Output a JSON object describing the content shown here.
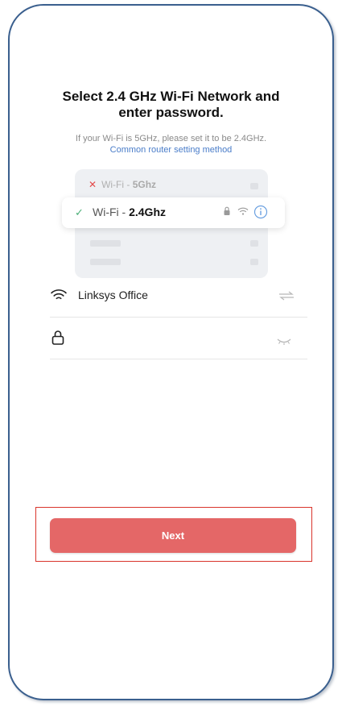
{
  "header": {
    "title_line1": "Select 2.4 GHz Wi-Fi Network and",
    "title_line2": "enter password.",
    "subtitle": "If your Wi-Fi is 5GHz, please set it to be 2.4GHz.",
    "router_link": "Common router setting method"
  },
  "illustration": {
    "bad_network_prefix": "Wi-Fi - ",
    "bad_network_band": "5Ghz",
    "good_network_prefix": "Wi-Fi - ",
    "good_network_band": "2.4Ghz",
    "bad_mark": "✕",
    "good_mark": "✓"
  },
  "form": {
    "ssid_value": "Linksys Office",
    "password_value": "",
    "password_placeholder": ""
  },
  "actions": {
    "next_label": "Next"
  },
  "colors": {
    "accent_button": "#e46767",
    "link": "#4a7dc9",
    "highlight_border": "#d9342b",
    "frame_border": "#3a5f8e"
  }
}
